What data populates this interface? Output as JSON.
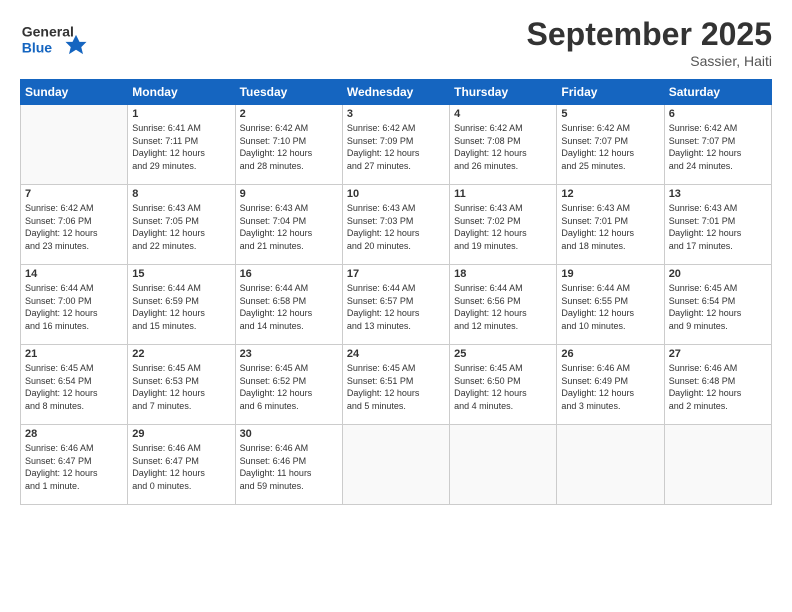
{
  "header": {
    "logo_line1": "General",
    "logo_line2": "Blue",
    "title": "September 2025",
    "subtitle": "Sassier, Haiti"
  },
  "days_of_week": [
    "Sunday",
    "Monday",
    "Tuesday",
    "Wednesday",
    "Thursday",
    "Friday",
    "Saturday"
  ],
  "weeks": [
    [
      {
        "day": "",
        "info": ""
      },
      {
        "day": "1",
        "info": "Sunrise: 6:41 AM\nSunset: 7:11 PM\nDaylight: 12 hours\nand 29 minutes."
      },
      {
        "day": "2",
        "info": "Sunrise: 6:42 AM\nSunset: 7:10 PM\nDaylight: 12 hours\nand 28 minutes."
      },
      {
        "day": "3",
        "info": "Sunrise: 6:42 AM\nSunset: 7:09 PM\nDaylight: 12 hours\nand 27 minutes."
      },
      {
        "day": "4",
        "info": "Sunrise: 6:42 AM\nSunset: 7:08 PM\nDaylight: 12 hours\nand 26 minutes."
      },
      {
        "day": "5",
        "info": "Sunrise: 6:42 AM\nSunset: 7:07 PM\nDaylight: 12 hours\nand 25 minutes."
      },
      {
        "day": "6",
        "info": "Sunrise: 6:42 AM\nSunset: 7:07 PM\nDaylight: 12 hours\nand 24 minutes."
      }
    ],
    [
      {
        "day": "7",
        "info": "Sunrise: 6:42 AM\nSunset: 7:06 PM\nDaylight: 12 hours\nand 23 minutes."
      },
      {
        "day": "8",
        "info": "Sunrise: 6:43 AM\nSunset: 7:05 PM\nDaylight: 12 hours\nand 22 minutes."
      },
      {
        "day": "9",
        "info": "Sunrise: 6:43 AM\nSunset: 7:04 PM\nDaylight: 12 hours\nand 21 minutes."
      },
      {
        "day": "10",
        "info": "Sunrise: 6:43 AM\nSunset: 7:03 PM\nDaylight: 12 hours\nand 20 minutes."
      },
      {
        "day": "11",
        "info": "Sunrise: 6:43 AM\nSunset: 7:02 PM\nDaylight: 12 hours\nand 19 minutes."
      },
      {
        "day": "12",
        "info": "Sunrise: 6:43 AM\nSunset: 7:01 PM\nDaylight: 12 hours\nand 18 minutes."
      },
      {
        "day": "13",
        "info": "Sunrise: 6:43 AM\nSunset: 7:01 PM\nDaylight: 12 hours\nand 17 minutes."
      }
    ],
    [
      {
        "day": "14",
        "info": "Sunrise: 6:44 AM\nSunset: 7:00 PM\nDaylight: 12 hours\nand 16 minutes."
      },
      {
        "day": "15",
        "info": "Sunrise: 6:44 AM\nSunset: 6:59 PM\nDaylight: 12 hours\nand 15 minutes."
      },
      {
        "day": "16",
        "info": "Sunrise: 6:44 AM\nSunset: 6:58 PM\nDaylight: 12 hours\nand 14 minutes."
      },
      {
        "day": "17",
        "info": "Sunrise: 6:44 AM\nSunset: 6:57 PM\nDaylight: 12 hours\nand 13 minutes."
      },
      {
        "day": "18",
        "info": "Sunrise: 6:44 AM\nSunset: 6:56 PM\nDaylight: 12 hours\nand 12 minutes."
      },
      {
        "day": "19",
        "info": "Sunrise: 6:44 AM\nSunset: 6:55 PM\nDaylight: 12 hours\nand 10 minutes."
      },
      {
        "day": "20",
        "info": "Sunrise: 6:45 AM\nSunset: 6:54 PM\nDaylight: 12 hours\nand 9 minutes."
      }
    ],
    [
      {
        "day": "21",
        "info": "Sunrise: 6:45 AM\nSunset: 6:54 PM\nDaylight: 12 hours\nand 8 minutes."
      },
      {
        "day": "22",
        "info": "Sunrise: 6:45 AM\nSunset: 6:53 PM\nDaylight: 12 hours\nand 7 minutes."
      },
      {
        "day": "23",
        "info": "Sunrise: 6:45 AM\nSunset: 6:52 PM\nDaylight: 12 hours\nand 6 minutes."
      },
      {
        "day": "24",
        "info": "Sunrise: 6:45 AM\nSunset: 6:51 PM\nDaylight: 12 hours\nand 5 minutes."
      },
      {
        "day": "25",
        "info": "Sunrise: 6:45 AM\nSunset: 6:50 PM\nDaylight: 12 hours\nand 4 minutes."
      },
      {
        "day": "26",
        "info": "Sunrise: 6:46 AM\nSunset: 6:49 PM\nDaylight: 12 hours\nand 3 minutes."
      },
      {
        "day": "27",
        "info": "Sunrise: 6:46 AM\nSunset: 6:48 PM\nDaylight: 12 hours\nand 2 minutes."
      }
    ],
    [
      {
        "day": "28",
        "info": "Sunrise: 6:46 AM\nSunset: 6:47 PM\nDaylight: 12 hours\nand 1 minute."
      },
      {
        "day": "29",
        "info": "Sunrise: 6:46 AM\nSunset: 6:47 PM\nDaylight: 12 hours\nand 0 minutes."
      },
      {
        "day": "30",
        "info": "Sunrise: 6:46 AM\nSunset: 6:46 PM\nDaylight: 11 hours\nand 59 minutes."
      },
      {
        "day": "",
        "info": ""
      },
      {
        "day": "",
        "info": ""
      },
      {
        "day": "",
        "info": ""
      },
      {
        "day": "",
        "info": ""
      }
    ]
  ]
}
